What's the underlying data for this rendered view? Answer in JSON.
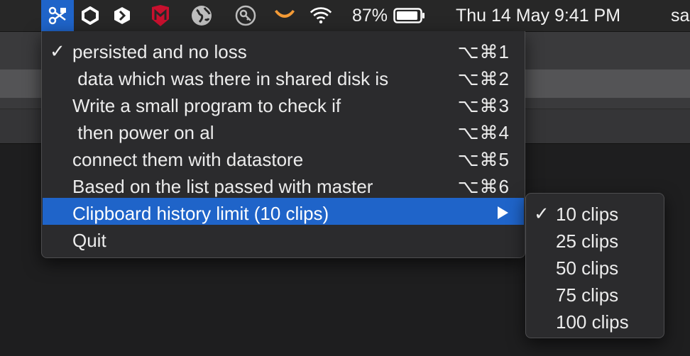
{
  "menubar": {
    "icons": [
      {
        "name": "clipboard-app-icon"
      },
      {
        "name": "hexagon-app-icon"
      },
      {
        "name": "shield-app-icon"
      },
      {
        "name": "mcafee-icon"
      },
      {
        "name": "globe-icon"
      },
      {
        "name": "key-icon"
      },
      {
        "name": "smile-icon"
      },
      {
        "name": "wifi-icon"
      },
      {
        "name": "battery-icon"
      }
    ],
    "battery_percent": "87%",
    "datetime": "Thu 14 May  9:41 PM",
    "user": "sa"
  },
  "menu": {
    "items": [
      {
        "checked": true,
        "label": "persisted and no loss",
        "shortcut": "⌥⌘1"
      },
      {
        "checked": false,
        "label": " data which was there in shared disk is",
        "shortcut": "⌥⌘2"
      },
      {
        "checked": false,
        "label": "Write a small program to check if",
        "shortcut": "⌥⌘3"
      },
      {
        "checked": false,
        "label": " then power on al",
        "shortcut": "⌥⌘4"
      },
      {
        "checked": false,
        "label": "connect them with datastore",
        "shortcut": "⌥⌘5"
      },
      {
        "checked": false,
        "label": "Based on the list passed with master",
        "shortcut": "⌥⌘6"
      },
      {
        "checked": false,
        "label": "Clipboard history limit (10 clips)",
        "has_submenu": true
      },
      {
        "checked": false,
        "label": "Quit"
      }
    ],
    "check_glyph": "✓",
    "highlight_color": "#1f64c9"
  },
  "submenu": {
    "items": [
      {
        "checked": true,
        "label": "10 clips"
      },
      {
        "checked": false,
        "label": "25 clips"
      },
      {
        "checked": false,
        "label": "50 clips"
      },
      {
        "checked": false,
        "label": "75 clips"
      },
      {
        "checked": false,
        "label": "100 clips"
      }
    ]
  }
}
